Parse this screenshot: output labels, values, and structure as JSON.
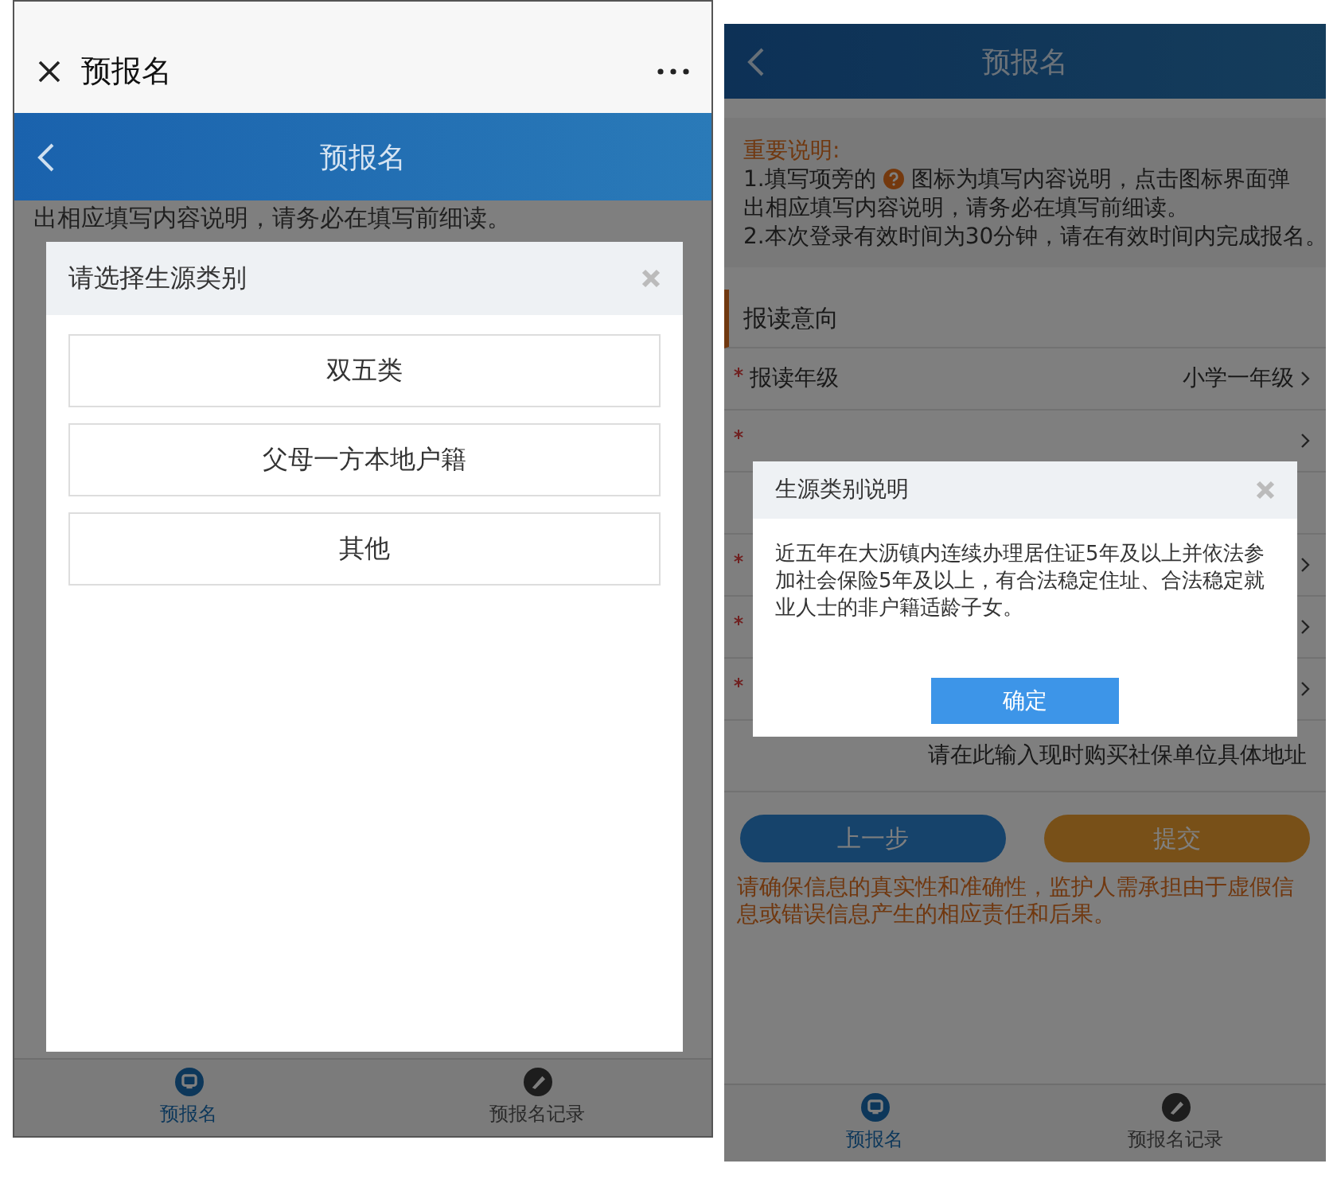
{
  "left_screen": {
    "top_bar": {
      "title": "预报名"
    },
    "nav_bar": {
      "title": "预报名"
    },
    "background_text": "出相应填写内容说明，请务必在填写前细读。",
    "dialog": {
      "title": "请选择生源类别",
      "options": [
        "双五类",
        "父母一方本地户籍",
        "其他"
      ]
    },
    "tab_bar": [
      {
        "label": "预报名",
        "selected": true,
        "kind": "form"
      },
      {
        "label": "预报名记录",
        "selected": false,
        "kind": "record"
      }
    ]
  },
  "right_screen": {
    "nav_bar": {
      "title": "预报名"
    },
    "notice": {
      "heading": "重要说明:",
      "item_1_before": "1.填写项旁的",
      "item_1_after": "图标为填写内容说明，点击图标界面弹",
      "item_1_cont": "出相应填写内容说明，请务必在填写前细读。",
      "item_2": "2.本次登录有效时间为30分钟，请在有效时间内完成报名。"
    },
    "section": "报读意向",
    "rows": [
      {
        "label": "报读年级",
        "value": "小学一年级"
      }
    ],
    "address_field": {
      "placeholder": "请在此输入现时购买社保单位具体地址"
    },
    "buttons": [
      {
        "label": "上一步",
        "kind": "secondary"
      },
      {
        "label": "提交",
        "kind": "primary"
      }
    ],
    "warning": "请确保信息的真实性和准确性，监护人需承担由于虚假信息或错误信息产生的相应责任和后果。",
    "dialog": {
      "title": "生源类别说明",
      "body": "近五年在大沥镇内连续办理居住证5年及以上并依法参加社会保险5年及以上，有合法稳定住址、合法稳定就业人士的非户籍适龄子女。",
      "confirm": "确定"
    },
    "tab_bar": [
      {
        "label": "预报名",
        "selected": true,
        "kind": "form"
      },
      {
        "label": "预报名记录",
        "selected": false,
        "kind": "record"
      }
    ]
  }
}
